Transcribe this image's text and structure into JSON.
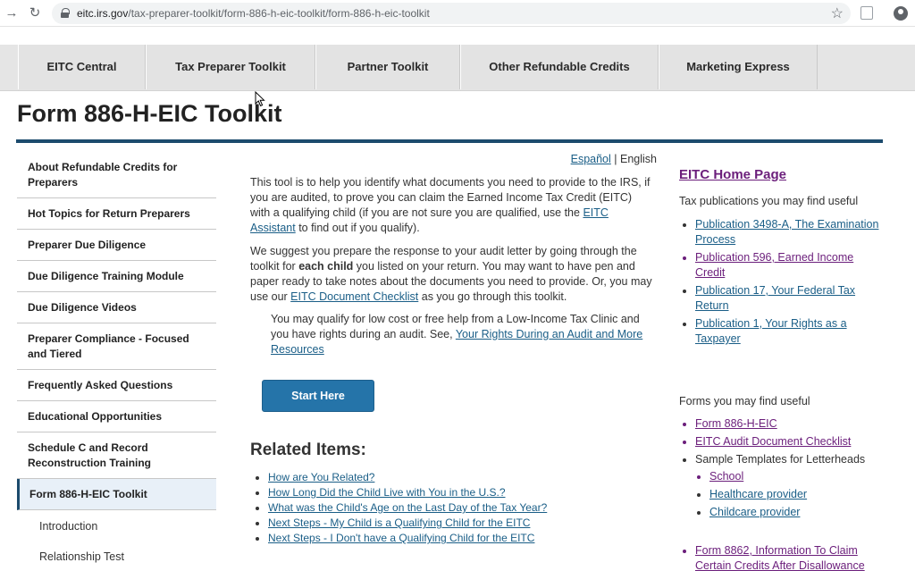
{
  "browser": {
    "url_host": "eitc.irs.gov",
    "url_path": "/tax-preparer-toolkit/form-886-h-eic-toolkit/form-886-h-eic-toolkit"
  },
  "topnav": {
    "tabs": [
      {
        "label": "EITC Central"
      },
      {
        "label": "Tax Preparer Toolkit"
      },
      {
        "label": "Partner Toolkit"
      },
      {
        "label": "Other Refundable Credits"
      },
      {
        "label": "Marketing Express"
      }
    ]
  },
  "page": {
    "title": "Form 886-H-EIC Toolkit"
  },
  "sidebar": {
    "items": [
      {
        "label": "About Refundable Credits for Preparers"
      },
      {
        "label": "Hot Topics for Return Preparers"
      },
      {
        "label": "Preparer Due Diligence"
      },
      {
        "label": "Due Diligence Training Module"
      },
      {
        "label": "Due Diligence Videos"
      },
      {
        "label": "Preparer Compliance - Focused and Tiered"
      },
      {
        "label": "Frequently Asked Questions"
      },
      {
        "label": "Educational Opportunities"
      },
      {
        "label": "Schedule C and Record Reconstruction Training"
      },
      {
        "label": "Form 886-H-EIC Toolkit"
      }
    ],
    "subitems": [
      {
        "label": "Introduction"
      },
      {
        "label": "Relationship Test"
      }
    ]
  },
  "main": {
    "lang_es": "Español",
    "lang_sep": " | ",
    "lang_en": "English",
    "para1_text": "This tool is to help you identify what documents you need to provide to the IRS, if you are audited, to prove you can claim the Earned Income Tax Credit (EITC) with a qualifying child (if you are not sure you are qualified, use the ",
    "para1_link": "EITC Assistant",
    "para1_end": " to find out if you qualify).",
    "para2_a": "We suggest you prepare the response to your audit letter by going through the toolkit for ",
    "para2_bold": "each child",
    "para2_b": " you listed on your return. You may want to have pen and paper ready to take notes about the documents you need to provide. Or, you may use our ",
    "para2_link": "EITC Document Checklist",
    "para2_c": " as you go through this toolkit.",
    "para3_text": "You may qualify for low cost or free help from a Low-Income Tax Clinic and you have rights during an audit. See, ",
    "para3_link": "Your Rights During an Audit and More Resources",
    "start_button": "Start Here",
    "related_title": "Related Items:",
    "related": [
      "How are You Related?",
      "How Long Did the Child Live with You in the U.S.?",
      "What was the Child's Age on the Last Day of the Tax Year?",
      "Next Steps - My Child is a Qualifying Child for the EITC",
      "Next Steps - I Don't have a Qualifying Child for the EITC"
    ]
  },
  "right": {
    "home_link": "EITC Home Page",
    "pubs_label": "Tax publications you may find useful",
    "pubs": [
      "Publication 3498-A, The Examination Process",
      "Publication 596, Earned Income Credit",
      "Publication 17, Your Federal Tax Return",
      "Publication 1, Your Rights as a Taxpayer"
    ],
    "forms_label": "Forms you may find useful",
    "forms": [
      "Form 886-H-EIC",
      "EITC Audit Document Checklist"
    ],
    "templates_label": "Sample Templates for Letterheads",
    "templates": [
      "School",
      "Healthcare provider",
      "Childcare provider"
    ],
    "form8862": "Form 8862, Information To Claim Certain Credits After Disallowance"
  },
  "colors": {
    "accent_navy": "#1c4b6d",
    "link_blue": "#1a5e87",
    "visited_purple": "#6b1e7b",
    "button_blue": "#2574a9"
  }
}
